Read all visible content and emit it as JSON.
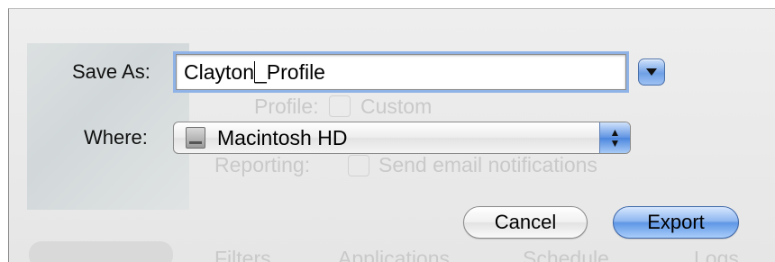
{
  "dialog": {
    "save_as_label": "Save As:",
    "filename_value_before_caret": "Clayton",
    "filename_value_after_caret": "_Profile",
    "where_label": "Where:",
    "location_value": "Macintosh HD",
    "disclosure_icon": "disclosure-triangle-icon",
    "location_icon": "hard-drive-icon",
    "cancel_label": "Cancel",
    "export_label": "Export"
  },
  "background": {
    "profile_label": "Profile:",
    "profile_value": "Custom",
    "reporting_label": "Reporting:",
    "reporting_value": "Send email notifications",
    "tabs": [
      "Filters",
      "Applications",
      "Schedule",
      "Logs"
    ]
  },
  "colors": {
    "focus_ring": "#8fb3e6",
    "default_button": "#5f97e6"
  }
}
